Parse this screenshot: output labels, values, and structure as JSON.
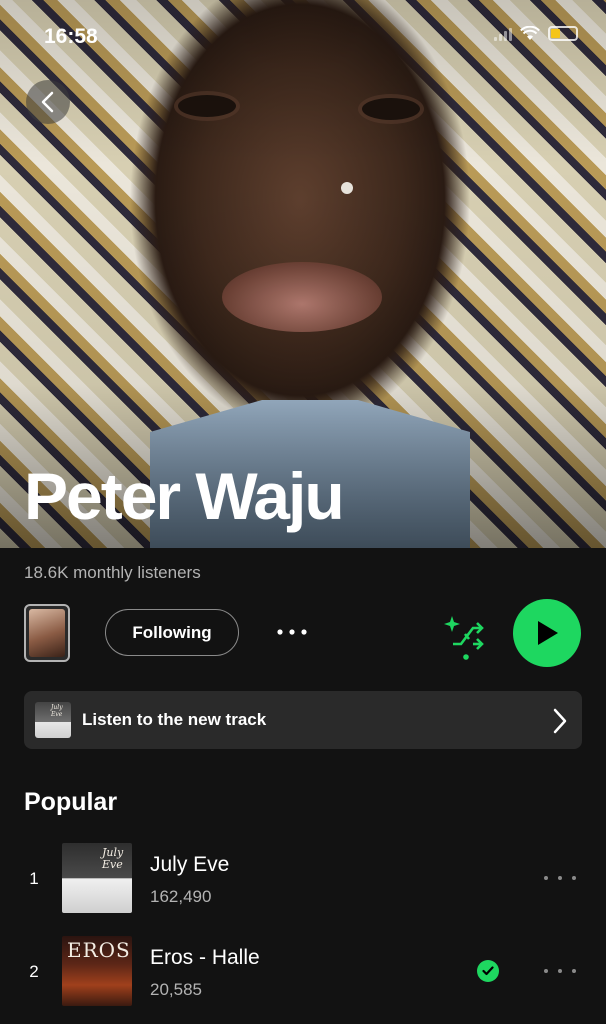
{
  "status_bar": {
    "time": "16:58"
  },
  "artist": {
    "name": "Peter Waju",
    "monthly_listeners": "18.6K monthly listeners"
  },
  "actions": {
    "follow_label": "Following",
    "more_label": "•••"
  },
  "promo": {
    "label": "Listen to the new track",
    "art_text": "July Eve"
  },
  "popular": {
    "title": "Popular",
    "tracks": [
      {
        "rank": "1",
        "title": "July Eve",
        "plays": "162,490",
        "saved": false,
        "art_text": "July Eve"
      },
      {
        "rank": "2",
        "title": "Eros - Halle",
        "plays": "20,585",
        "saved": true,
        "art_text": "EROS"
      }
    ]
  },
  "colors": {
    "accent": "#1ed760",
    "background": "#121212",
    "card": "#2a2a2a",
    "muted_text": "#b3b3b3"
  }
}
